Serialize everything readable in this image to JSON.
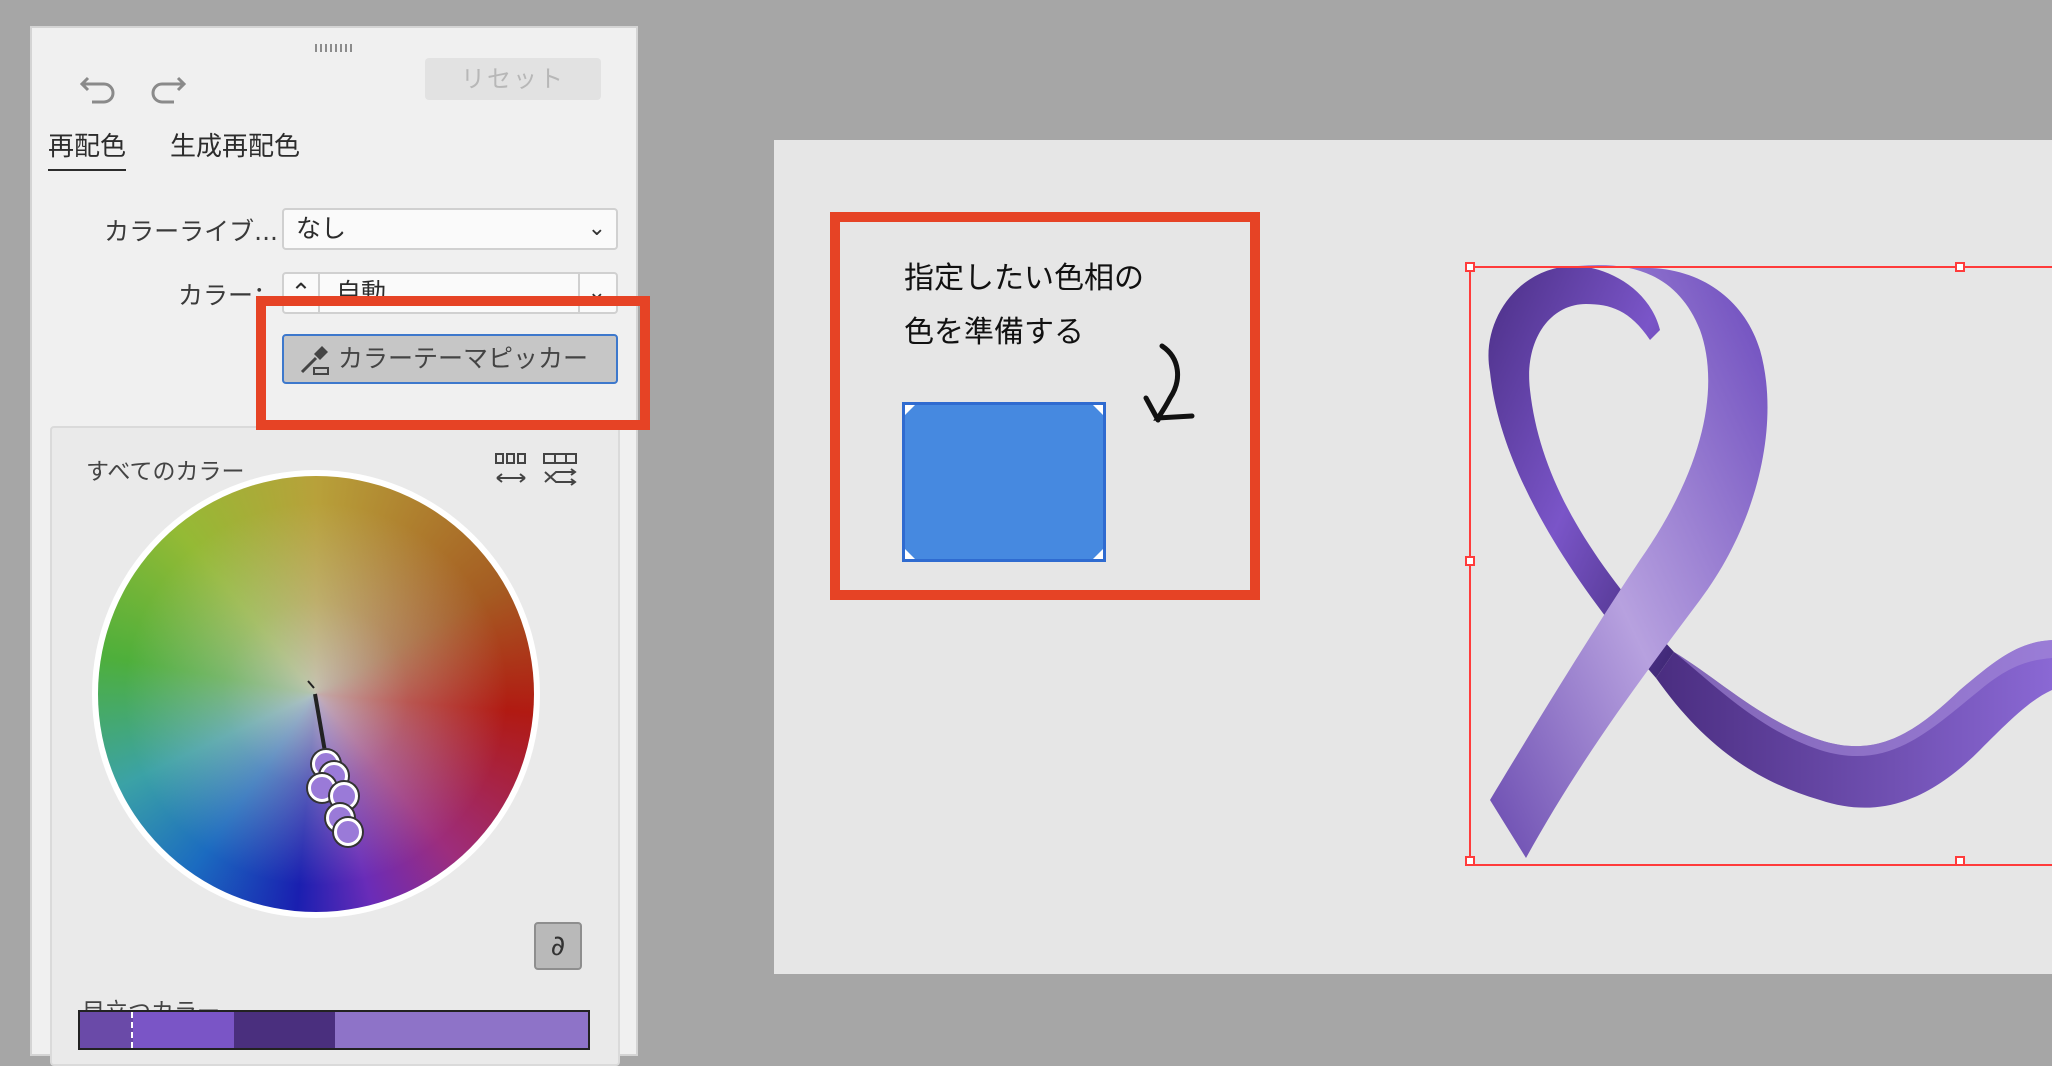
{
  "panel": {
    "undo_icon": "undo-icon",
    "redo_icon": "redo-icon",
    "reset_label": "リセット",
    "tabs": [
      {
        "label": "再配色",
        "active": true
      },
      {
        "label": "生成再配色",
        "active": false
      }
    ],
    "color_library_label": "カラーライブ...",
    "color_library_value": "なし",
    "colors_label": "カラー：",
    "colors_value": "自動",
    "picker_button_label": "カラーテーマピッカー",
    "all_colors_label": "すべてのカラー",
    "prominent_colors_label": "目立つカラー",
    "swatches": [
      "#6a4aa8",
      "#7a55c6",
      "#4a2f7e",
      "#8e73c8"
    ]
  },
  "canvas": {
    "note_lines": [
      "指定したい色相の",
      "色を準備する"
    ],
    "rect_color": "#4689e0",
    "highlight_color": "#e64325"
  }
}
